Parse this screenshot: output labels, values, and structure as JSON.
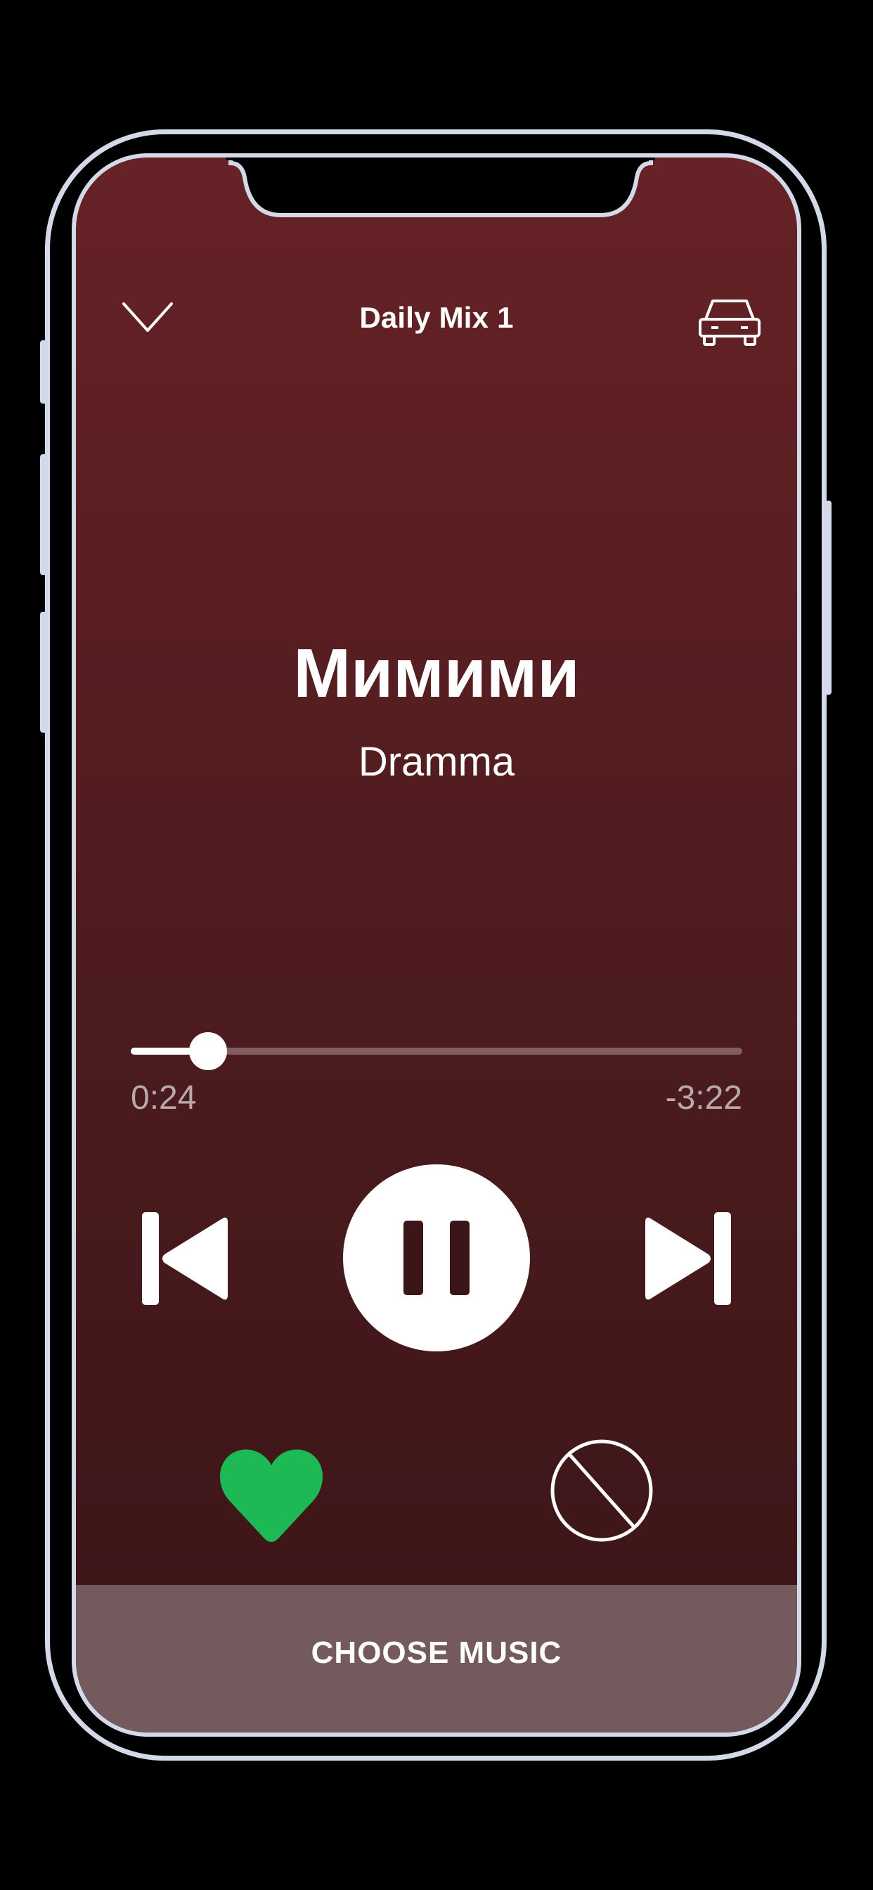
{
  "header": {
    "title": "Daily Mix 1",
    "collapse_icon": "chevron-down-icon",
    "car_icon": "car-icon"
  },
  "track": {
    "title": "Мимими",
    "artist": "Dramma"
  },
  "progress": {
    "elapsed": "0:24",
    "remaining": "-3:22",
    "fraction": 0.127
  },
  "controls": {
    "previous_icon": "skip-previous-icon",
    "pause_icon": "pause-icon",
    "next_icon": "skip-next-icon",
    "like_icon": "heart-icon",
    "ban_icon": "block-icon"
  },
  "footer": {
    "choose_music_label": "CHOOSE MUSIC"
  },
  "colors": {
    "background_top": "#662226",
    "background_bottom": "#3a1517",
    "like_green": "#1db954",
    "footer_bar": "#745a5c",
    "time_text": "#b9a9aa"
  }
}
